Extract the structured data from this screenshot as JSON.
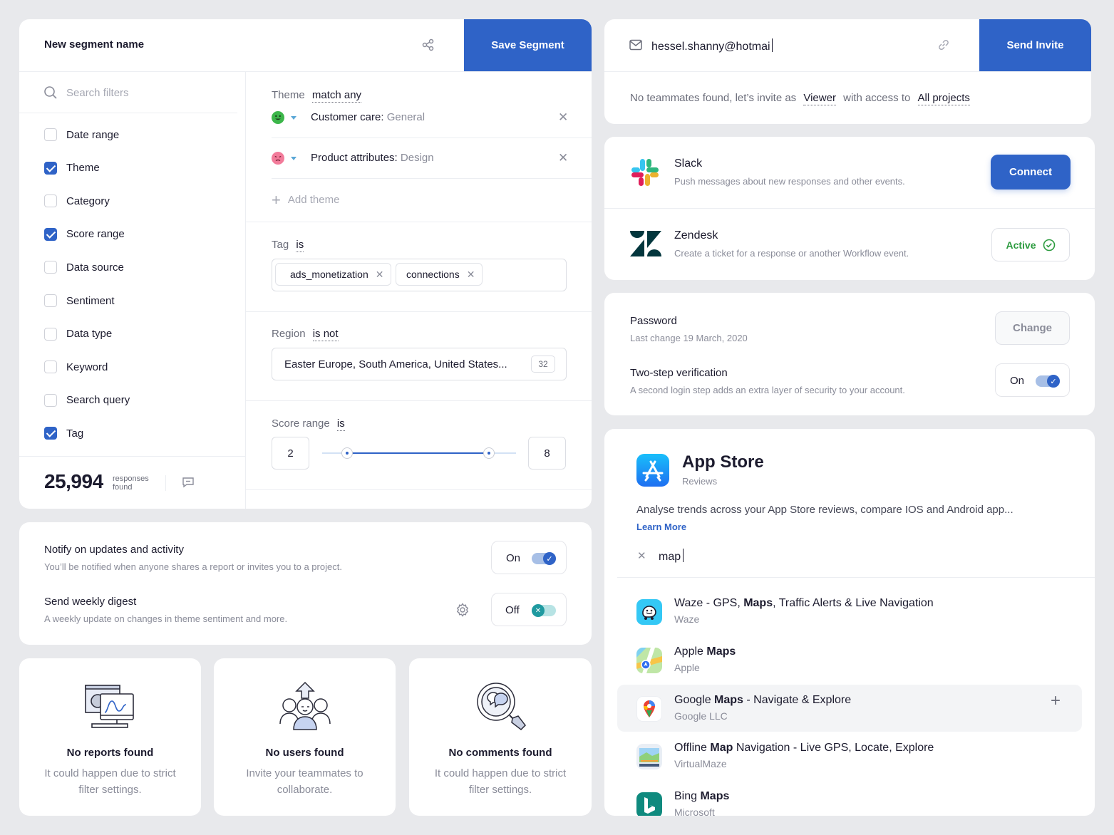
{
  "segment": {
    "name_label": "New segment name",
    "save_label": "Save Segment",
    "search_placeholder": "Search filters",
    "filters": [
      {
        "label": "Date range",
        "checked": false
      },
      {
        "label": "Theme",
        "checked": true
      },
      {
        "label": "Category",
        "checked": false
      },
      {
        "label": "Score range",
        "checked": true
      },
      {
        "label": "Data source",
        "checked": false
      },
      {
        "label": "Sentiment",
        "checked": false
      },
      {
        "label": "Data type",
        "checked": false
      },
      {
        "label": "Keyword",
        "checked": false
      },
      {
        "label": "Search query",
        "checked": false
      },
      {
        "label": "Tag",
        "checked": true
      }
    ],
    "count": "25,994",
    "count_label_1": "responses",
    "count_label_2": "found",
    "theme_label": "Theme",
    "theme_op": "match any",
    "themes": [
      {
        "name": "Customer care:",
        "value": "General"
      },
      {
        "name": "Product attributes:",
        "value": "Design"
      }
    ],
    "add_theme": "Add theme",
    "tag_label": "Tag",
    "tag_op": "is",
    "tags": [
      "ads_monetization",
      "connections"
    ],
    "region_label": "Region",
    "region_op": "is not",
    "region_value": "Easter Europe, South America, United States...",
    "region_count": "32",
    "score_label": "Score range",
    "score_op": "is",
    "score_min": "2",
    "score_max": "8",
    "score_min_frac": 0.13,
    "score_max_frac": 0.86
  },
  "invite": {
    "email": "hessel.shanny@hotmai",
    "send_label": "Send Invite",
    "msg_prefix": "No teammates found, let’s invite as",
    "role": "Viewer",
    "msg_mid": "with access to",
    "scope": "All projects"
  },
  "integrations": [
    {
      "name": "Slack",
      "desc": "Push messages about new responses and other events.",
      "action": "Connect"
    },
    {
      "name": "Zendesk",
      "desc": "Create a ticket for a response or another Workflow event.",
      "action": "Active"
    }
  ],
  "security": {
    "password_title": "Password",
    "password_sub": "Last change 19 March, 2020",
    "change_label": "Change",
    "twostep_title": "Two-step verification",
    "twostep_sub": "A second login step adds an extra layer of security to your account.",
    "twostep_state": "On"
  },
  "notifications": {
    "notify_title": "Notify on updates and activity",
    "notify_sub": "You’ll be notified when anyone shares a report or invites you to a project.",
    "notify_state": "On",
    "digest_title": "Send weekly digest",
    "digest_sub": "A weekly update on changes in theme sentiment and more.",
    "digest_state": "Off"
  },
  "empty_states": [
    {
      "title": "No reports found",
      "line1": "It could happen due to strict",
      "line2": "filter settings."
    },
    {
      "title": "No users found",
      "line1": "Invite your teammates to",
      "line2": "collaborate."
    },
    {
      "title": "No comments found",
      "line1": "It could happen due to strict",
      "line2": "filter settings."
    }
  ],
  "appstore": {
    "title": "App Store",
    "subtitle": "Reviews",
    "desc": "Analyse trends across your App Store reviews, compare IOS and Android app...",
    "learn_more": "Learn More",
    "query": "map",
    "results": [
      {
        "pre": "Waze - GPS, ",
        "bold": "Maps",
        "post": ", Traffic Alerts & Live Navigation",
        "dev": "Waze",
        "icon": "waze-icon"
      },
      {
        "pre": "Apple ",
        "bold": "Maps",
        "post": "",
        "dev": "Apple",
        "icon": "apple-maps-icon"
      },
      {
        "pre": "Google ",
        "bold": "Maps",
        "post": " - Navigate & Explore",
        "dev": "Google LLC",
        "icon": "google-maps-icon"
      },
      {
        "pre": "Offline ",
        "bold": "Map",
        "post": " Navigation - Live GPS, Locate, Explore",
        "dev": "VirtualMaze",
        "icon": "offline-map-icon"
      },
      {
        "pre": "Bing ",
        "bold": "Maps",
        "post": "",
        "dev": "Microsoft",
        "icon": "bing-maps-icon"
      }
    ]
  },
  "colors": {
    "primary": "#2f63c7",
    "success": "#2c9b3f",
    "teal": "#1f9aa0"
  }
}
